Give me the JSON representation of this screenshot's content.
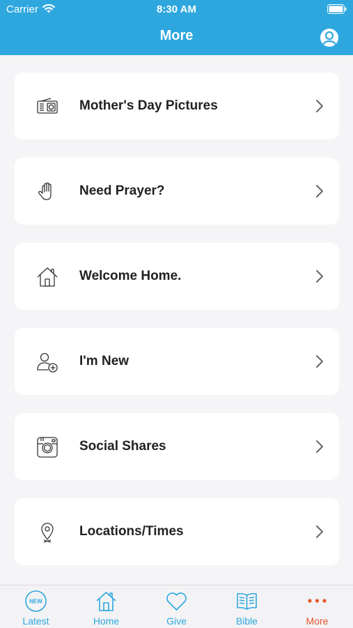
{
  "status_bar": {
    "carrier": "Carrier",
    "time": "8:30 AM"
  },
  "header": {
    "title": "More"
  },
  "menu": [
    {
      "label": "Mother's Day Pictures",
      "icon": "radio-icon"
    },
    {
      "label": "Need Prayer?",
      "icon": "hand-icon"
    },
    {
      "label": "Welcome Home.",
      "icon": "house-icon"
    },
    {
      "label": "I'm New",
      "icon": "add-user-icon"
    },
    {
      "label": "Social Shares",
      "icon": "instagram-icon"
    },
    {
      "label": "Locations/Times",
      "icon": "location-pin-icon"
    }
  ],
  "tabs": [
    {
      "label": "Latest",
      "icon": "new-badge-icon",
      "badge": "NEW"
    },
    {
      "label": "Home",
      "icon": "home-icon"
    },
    {
      "label": "Give",
      "icon": "heart-icon"
    },
    {
      "label": "Bible",
      "icon": "open-book-icon"
    },
    {
      "label": "More",
      "icon": "more-dots-icon",
      "active": true
    }
  ],
  "colors": {
    "header_bg": "#2ea7df",
    "tab_active": "#e8552d",
    "tab_inactive": "#2ea7df",
    "page_bg": "#f5f5f7"
  }
}
